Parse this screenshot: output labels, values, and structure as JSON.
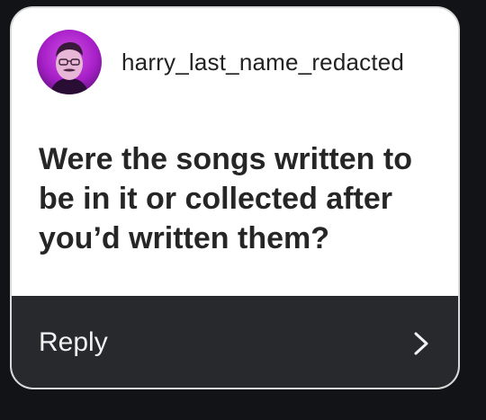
{
  "author": {
    "username": "harry_last_name_redacted",
    "avatar_icon": "profile-photo"
  },
  "question": {
    "text": "Were the songs written to be in it or collected after you’d written them?"
  },
  "reply": {
    "label": "Reply",
    "icon": "chevron-right-icon"
  },
  "colors": {
    "background": "#121317",
    "card": "#ffffff",
    "reply_bar": "#27292d",
    "avatar_ring": "#b02bd6"
  }
}
